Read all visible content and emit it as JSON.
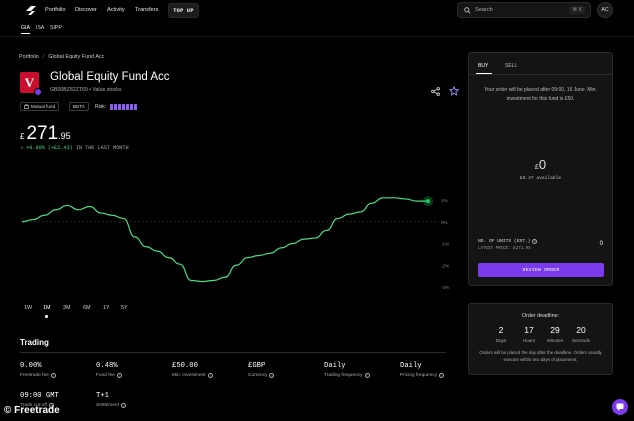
{
  "nav": {
    "links": [
      "Portfolio",
      "Discover",
      "Activity",
      "Transfers"
    ],
    "topup": "TOP UP",
    "search_placeholder": "Search",
    "search_kbd": "⌘ K",
    "avatar": "AC"
  },
  "account_tabs": [
    "GIA",
    "ISA",
    "SIPP"
  ],
  "breadcrumb": {
    "root": "Portfolio",
    "sep": "/",
    "current": "Global Equity Fund Acc"
  },
  "fund": {
    "logo_letter": "V",
    "title": "Global Equity Fund Acc",
    "subtitle": "GB00BZ82ZT69 • Value stocks",
    "chip_type": "Mutual fund",
    "chip_beta": "BETA",
    "risk_label": "Risk:",
    "risk_level": 7,
    "risk_max": 7
  },
  "price": {
    "currency": "£",
    "integer": "271",
    "decimal": ".95"
  },
  "change": {
    "arrow": "↗",
    "value": "+0.90%",
    "abs": "(+£2.43)",
    "period": "IN THE LAST MONTH"
  },
  "chart_data": {
    "type": "line",
    "y_tick_labels": [
      "1%",
      "0%",
      "-1%",
      "-2%",
      "-3%"
    ],
    "ylim": [
      -3,
      1
    ],
    "grid": false,
    "baseline": 0,
    "colors": {
      "line": "#4ade80",
      "marker": "#22c55e"
    },
    "series": [
      {
        "values": [
          0,
          0.1,
          0.3,
          0.55,
          0.75,
          0.55,
          0.7,
          0.4,
          0.3,
          0.15,
          -0.7,
          -1.15,
          -1.35,
          -1.65,
          -1.95,
          -2.7,
          -2.75,
          -2.7,
          -2.55,
          -2.0,
          -1.65,
          -1.55,
          -1.45,
          -1.2,
          -1.0,
          -0.8,
          -0.75,
          -0.4,
          0.15,
          0.35,
          0.45,
          0.85,
          1.1,
          1.1,
          1.05,
          0.95,
          0.95
        ]
      }
    ]
  },
  "ranges": [
    "1W",
    "1M",
    "3M",
    "6M",
    "1Y",
    "5Y"
  ],
  "active_range": "1M",
  "trading": {
    "title": "Trading",
    "stats": [
      {
        "value": "0.00%",
        "label": "Freetrade fee"
      },
      {
        "value": "0.48%",
        "label": "Fund fee"
      },
      {
        "value": "£50.00",
        "label": "Min. investment"
      },
      {
        "value": "£GBP",
        "label": "Currency"
      },
      {
        "value": "Daily",
        "label": "Trading frequency"
      },
      {
        "value": "Daily",
        "label": "Pricing frequency"
      },
      {
        "value": "09:00 GMT",
        "label": "Trade cut-off"
      },
      {
        "value": "T+1",
        "label": "Settlement"
      }
    ]
  },
  "order": {
    "tab_buy": "BUY",
    "tab_sell": "SELL",
    "note": "Your order will be placed after 09:00, 16 June. Min. investment for this fund is £50.",
    "amount_currency": "£",
    "amount": "0",
    "available": "£0.47 available",
    "units_label": "NO. OF UNITS (EST.)",
    "units_value": "0",
    "latest_price": "LATEST PRICE: £271.95",
    "review_button": "REVIEW ORDER"
  },
  "deadline": {
    "title": "Order deadline:",
    "countdown": [
      {
        "num": "2",
        "label": "Days"
      },
      {
        "num": "17",
        "label": "Hours"
      },
      {
        "num": "29",
        "label": "Minutes"
      },
      {
        "num": "20",
        "label": "Seconds"
      }
    ],
    "note": "Orders will be placed the day after the deadline. Orders usually execute within two days of placement."
  },
  "footer": {
    "watermark": "© Freetrade"
  },
  "colors": {
    "accent": "#7c3aed",
    "positive": "#4ade80",
    "fund_brand": "#c8102e"
  }
}
